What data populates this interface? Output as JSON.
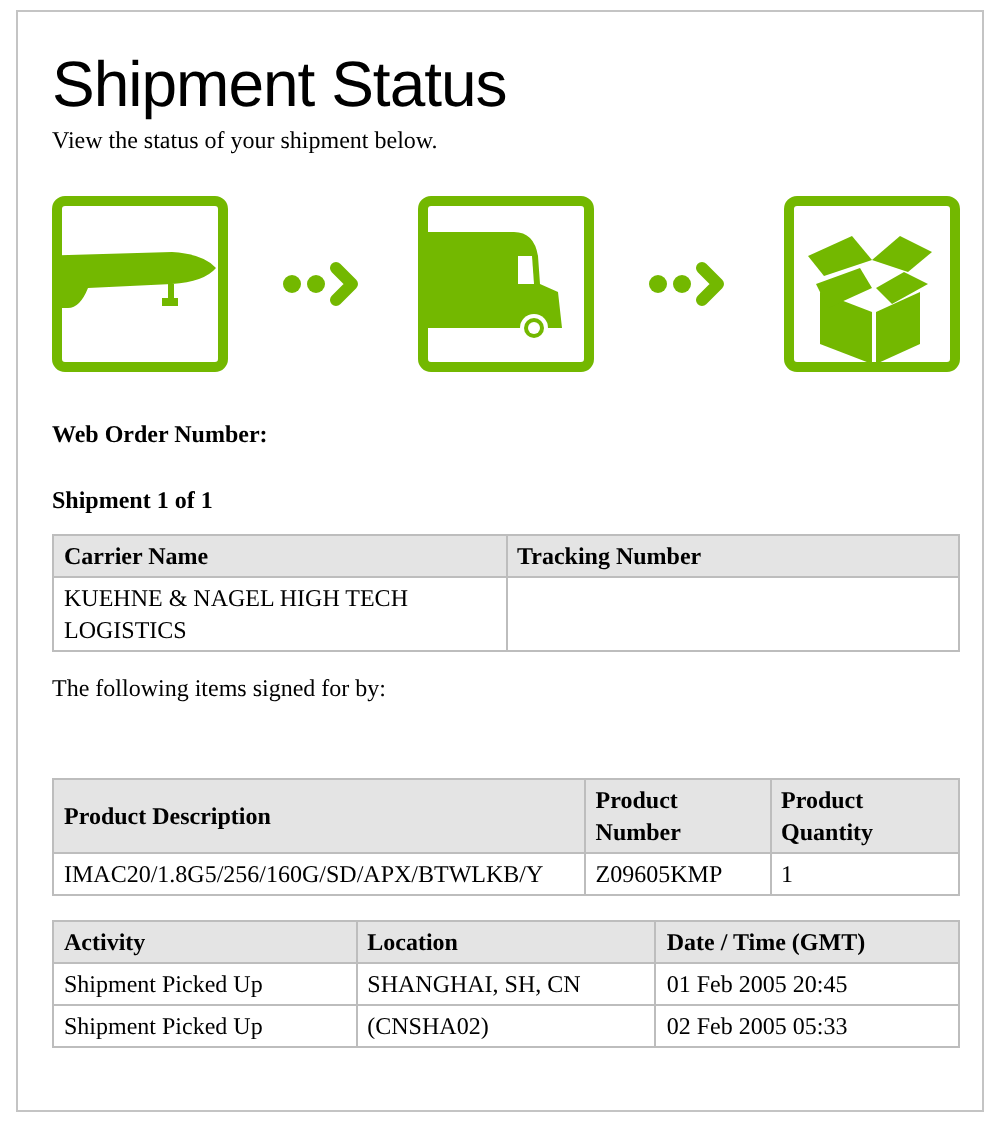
{
  "title": "Shipment Status",
  "subtitle": "View the status of your shipment below.",
  "web_order_label": "Web Order Number:",
  "shipment_label": "Shipment 1 of 1",
  "carrier_table": {
    "columns": [
      "Carrier Name",
      "Tracking Number"
    ],
    "rows": [
      {
        "cells": [
          "KUEHNE & NAGEL HIGH TECH LOGISTICS"
        ]
      }
    ]
  },
  "signed_for_text": "The following items signed for by:",
  "products_table": {
    "columns": [
      "Product Description",
      "Product Number",
      "Product Quantity"
    ],
    "rows": [
      {
        "cells": [
          "IMAC20/1.8G5/256/160G/SD/APX/BTWLKB/Y",
          "Z09605KMP",
          "1"
        ]
      }
    ]
  },
  "activity_table": {
    "columns": [
      "Activity",
      "Location",
      "Date / Time (GMT)"
    ],
    "rows": [
      {
        "cells": [
          "Shipment Picked Up",
          "SHANGHAI, SH, CN",
          "01 Feb 2005 20:45"
        ]
      },
      {
        "cells": [
          "Shipment Picked Up",
          "(CNSHA02)",
          "02 Feb 2005 05:33"
        ]
      }
    ]
  }
}
